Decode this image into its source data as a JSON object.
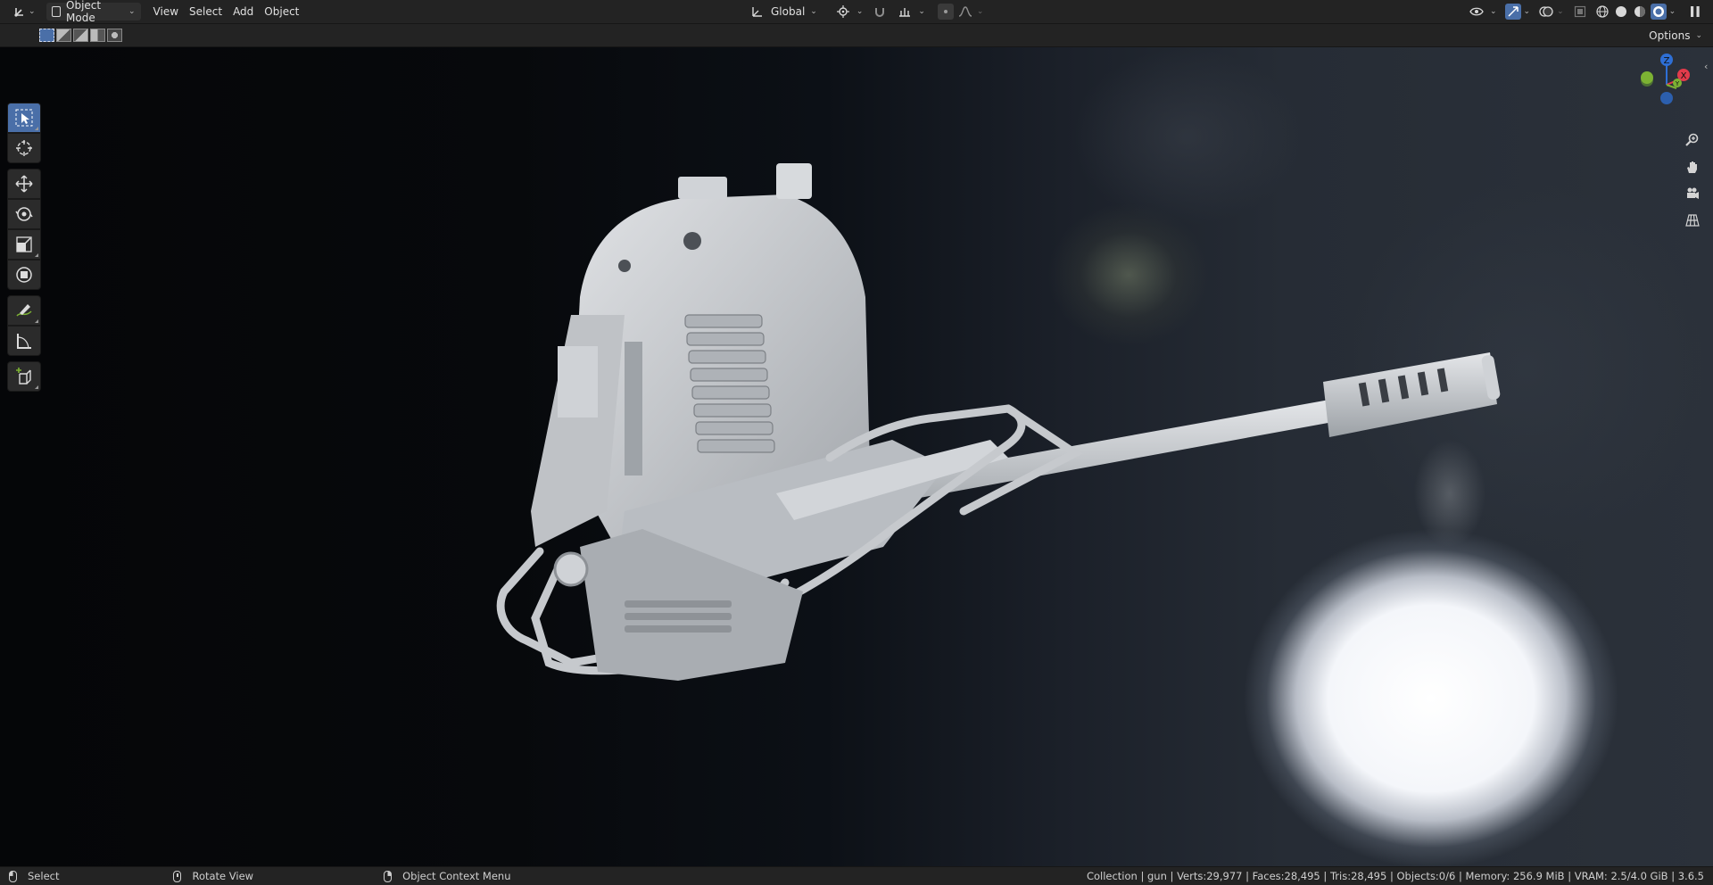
{
  "header": {
    "editor_type_icon": "3d-viewport-icon",
    "mode": "Object Mode",
    "menus": [
      "View",
      "Select",
      "Add",
      "Object"
    ],
    "orientation": "Global",
    "pause_icon": "pause-icon"
  },
  "subheader": {
    "select_modes": [
      "select-new-icon",
      "select-extend-icon",
      "select-subtract-icon",
      "select-invert-icon",
      "select-intersect-icon"
    ],
    "options_label": "Options"
  },
  "tools": [
    {
      "name": "select-box-icon",
      "active": true
    },
    {
      "name": "cursor-icon",
      "active": false
    },
    {
      "name": "move-icon",
      "active": false
    },
    {
      "name": "rotate-icon",
      "active": false
    },
    {
      "name": "scale-icon",
      "active": false
    },
    {
      "name": "transform-icon",
      "active": false
    },
    {
      "name": "annotate-icon",
      "active": false
    },
    {
      "name": "measure-icon",
      "active": false
    },
    {
      "name": "add-cube-icon",
      "active": false
    }
  ],
  "gizmo": {
    "z": "Z",
    "x": "X",
    "y": "Y",
    "colors": {
      "z": "#2e6fd6",
      "x": "#e23b4b",
      "y": "#7cb233"
    }
  },
  "statusbar": {
    "select": "Select",
    "rotate": "Rotate View",
    "context": "Object Context Menu",
    "stats": "Collection | gun | Verts:29,977 | Faces:28,495 | Tris:28,495 | Objects:0/6 | Memory: 256.9 MiB | VRAM: 2.5/4.0 GiB | 3.6.5"
  },
  "colors": {
    "accent": "#4a6fa8",
    "header_bg": "#232323"
  }
}
